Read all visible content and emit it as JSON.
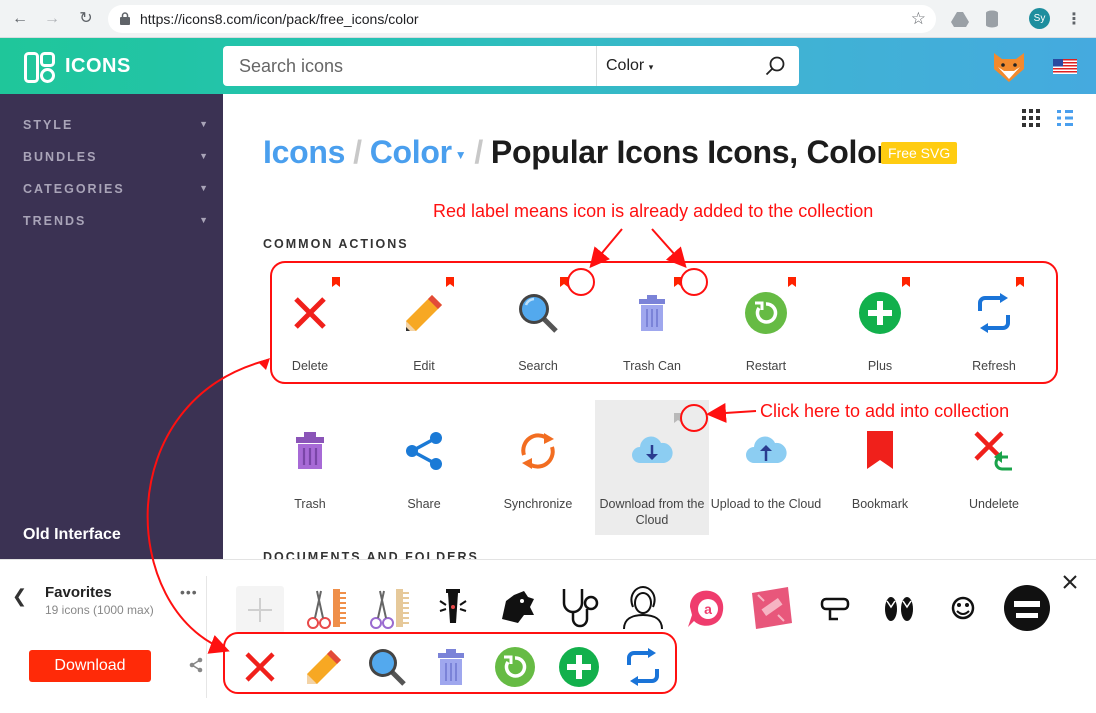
{
  "browser": {
    "url": "https://icons8.com/icon/pack/free_icons/color",
    "profile_initials": "Sy"
  },
  "header": {
    "logo_text": "ICONS",
    "search_placeholder": "Search icons",
    "style_select": "Color"
  },
  "sidebar": {
    "items": [
      {
        "label": "STYLE"
      },
      {
        "label": "BUNDLES"
      },
      {
        "label": "CATEGORIES"
      },
      {
        "label": "TRENDS"
      }
    ],
    "old_interface": "Old Interface"
  },
  "breadcrumb": {
    "root": "Icons",
    "style": "Color",
    "current": "Popular Icons Icons, Color",
    "badge": "Free SVG"
  },
  "sections": {
    "common_actions": "COMMON ACTIONS",
    "documents": "DOCUMENTS AND FOLDERS"
  },
  "icons_row1": [
    {
      "label": "Delete",
      "icon": "delete-icon"
    },
    {
      "label": "Edit",
      "icon": "pencil-icon"
    },
    {
      "label": "Search",
      "icon": "magnifier-icon"
    },
    {
      "label": "Trash Can",
      "icon": "trash-can-icon"
    },
    {
      "label": "Restart",
      "icon": "restart-icon"
    },
    {
      "label": "Plus",
      "icon": "plus-icon"
    },
    {
      "label": "Refresh",
      "icon": "refresh-icon"
    }
  ],
  "icons_row2": [
    {
      "label": "Trash",
      "icon": "trash-icon"
    },
    {
      "label": "Share",
      "icon": "share-icon"
    },
    {
      "label": "Synchronize",
      "icon": "sync-icon"
    },
    {
      "label": "Download from the Cloud",
      "icon": "cloud-download-icon"
    },
    {
      "label": "Upload to the Cloud",
      "icon": "cloud-upload-icon"
    },
    {
      "label": "Bookmark",
      "icon": "bookmark-icon"
    },
    {
      "label": "Undelete",
      "icon": "undelete-icon"
    }
  ],
  "favorites": {
    "title": "Favorites",
    "count": "19 icons (1000 max)",
    "download_label": "Download"
  },
  "annotations": {
    "red_label_note": "Red label means icon is already added to the collection",
    "click_note": "Click here to add into collection"
  },
  "colors": {
    "accent_red": "#ff1010",
    "sidebar_bg": "#3b3253",
    "link_blue": "#4a9fee",
    "badge_yellow": "#ffcc11",
    "download_red": "#ff2a08"
  }
}
